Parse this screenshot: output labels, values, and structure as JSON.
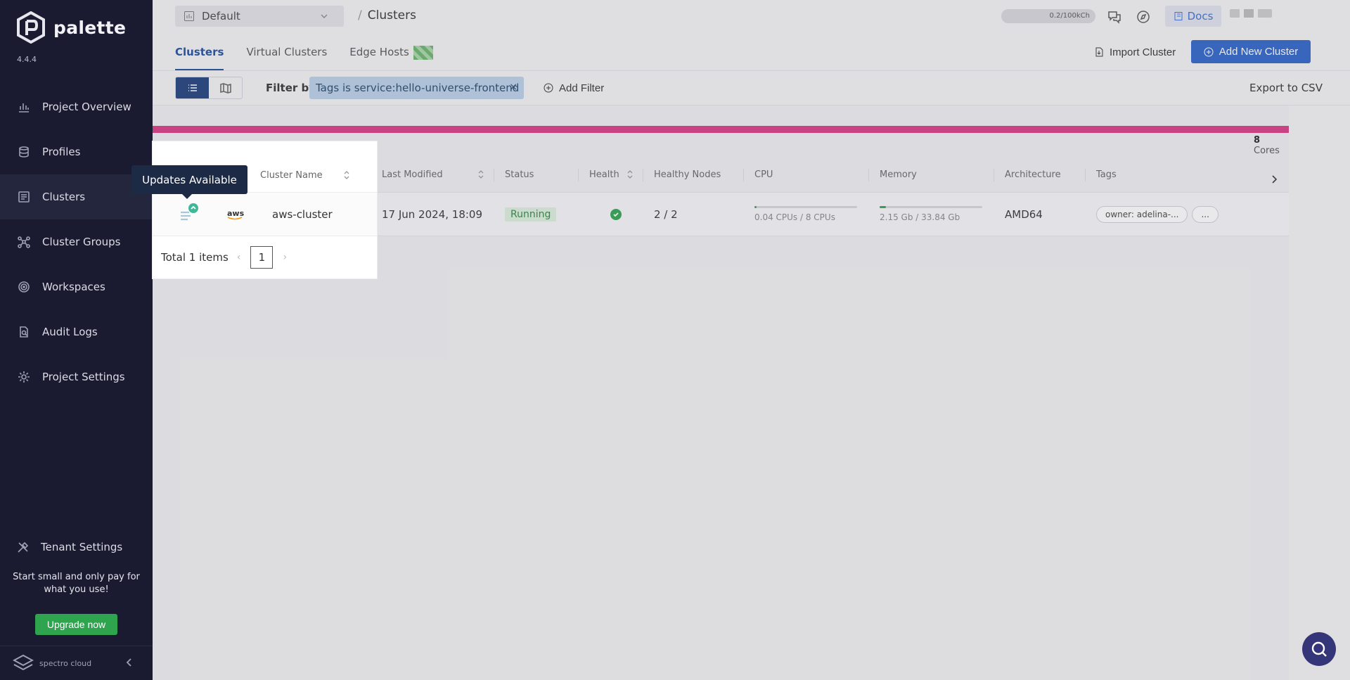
{
  "sidebar": {
    "brand": "palette",
    "version": "4.4.4",
    "items": [
      {
        "label": "Project Overview",
        "icon": "chart-icon"
      },
      {
        "label": "Profiles",
        "icon": "layers-icon"
      },
      {
        "label": "Clusters",
        "icon": "clusters-icon"
      },
      {
        "label": "Cluster Groups",
        "icon": "nodes-icon"
      },
      {
        "label": "Workspaces",
        "icon": "target-icon"
      },
      {
        "label": "Audit Logs",
        "icon": "audit-icon"
      },
      {
        "label": "Project Settings",
        "icon": "gear-icon"
      }
    ],
    "tenant_settings": "Tenant Settings",
    "promo": "Start small and only pay for what you use!",
    "upgrade": "Upgrade now",
    "footer_brand": "spectro cloud"
  },
  "topbar": {
    "project": "Default",
    "breadcrumb_sep": "/",
    "breadcrumb": "Clusters",
    "credits": "0.2/100kCh",
    "docs": "Docs"
  },
  "tabs": [
    {
      "label": "Clusters",
      "active": true
    },
    {
      "label": "Virtual Clusters",
      "active": false
    },
    {
      "label": "Edge Hosts",
      "active": false
    }
  ],
  "actions": {
    "import": "Import Cluster",
    "add": "Add New Cluster"
  },
  "filter": {
    "label": "Filter by:",
    "chip": "Tags is service:hello-universe-frontend",
    "chip_close": "×",
    "add_filter": "Add Filter",
    "export": "Export to CSV"
  },
  "usage": {
    "cores_value": "8",
    "cores_label": "Cores"
  },
  "table": {
    "headers": {
      "name": "Cluster Name",
      "modified": "Last Modified",
      "status": "Status",
      "health": "Health",
      "nodes": "Healthy Nodes",
      "cpu": "CPU",
      "memory": "Memory",
      "arch": "Architecture",
      "tags": "Tags"
    },
    "rows": [
      {
        "cloud": "aws",
        "name": "aws-cluster",
        "modified": "17 Jun 2024, 18:09",
        "status": "Running",
        "nodes": "2 / 2",
        "cpu_text": "0.04 CPUs / 8 CPUs",
        "cpu_fraction": 0.005,
        "memory_text": "2.15 Gb / 33.84 Gb",
        "memory_fraction": 0.064,
        "arch": "AMD64",
        "tag": "owner: adelina-...",
        "more": "..."
      }
    ]
  },
  "pager": {
    "total": "Total 1 items",
    "page": "1"
  },
  "tooltip": "Updates Available",
  "colors": {
    "sidebar_bg": "#1a1b30",
    "primary": "#2e63c9",
    "usage_bar": "#d93a83",
    "success": "#2ea44f"
  }
}
